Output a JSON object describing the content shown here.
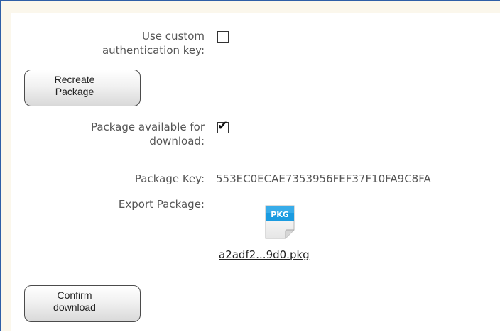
{
  "form": {
    "custom_key": {
      "label_line1": "Use custom",
      "label_line2": "authentication key:",
      "checked": false
    },
    "recreate_button": {
      "label": "Recreate Package"
    },
    "available": {
      "label_line1": "Package available for",
      "label_line2": "download:",
      "checked": true,
      "check_glyph": "✔"
    },
    "package_key": {
      "label": "Package Key:",
      "value": "553EC0ECAE7353956FEF37F10FA9C8FA"
    },
    "export": {
      "label": "Export Package:",
      "icon": "pkg-file-icon",
      "icon_text": "PKG",
      "file_name": "a2adf2...9d0.pkg"
    },
    "confirm_button": {
      "label": "Confirm download"
    }
  },
  "colors": {
    "frame_border": "#2f5fa7",
    "frame_background": "#fbf7ec",
    "label_text": "#555555",
    "pkg_icon_blue": "#1a9be0"
  }
}
